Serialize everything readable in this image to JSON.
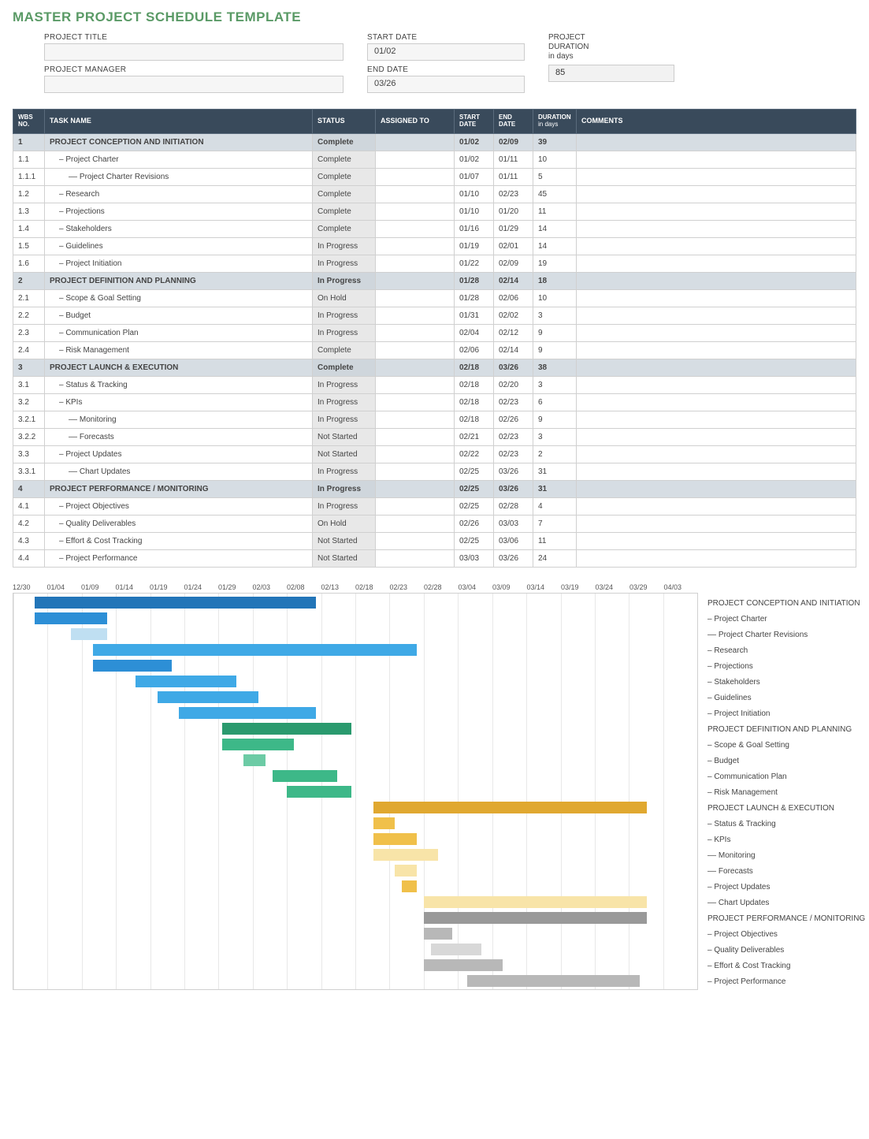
{
  "title": "MASTER PROJECT SCHEDULE TEMPLATE",
  "header": {
    "project_title_label": "PROJECT TITLE",
    "project_title": "",
    "project_manager_label": "PROJECT MANAGER",
    "project_manager": "",
    "start_date_label": "START DATE",
    "start_date": "01/02",
    "end_date_label": "END DATE",
    "end_date": "03/26",
    "project_duration_label1": "PROJECT",
    "project_duration_label2": "DURATION",
    "project_duration_unit": "in days",
    "project_duration": "85"
  },
  "columns": {
    "wbs": "WBS NO.",
    "task": "TASK NAME",
    "status": "STATUS",
    "assigned": "ASSIGNED TO",
    "start": "START DATE",
    "end": "END DATE",
    "duration": "DURATION",
    "duration_sub": "in days",
    "comments": "COMMENTS"
  },
  "rows": [
    {
      "sec": true,
      "wbs": "1",
      "task": "PROJECT CONCEPTION AND INITIATION",
      "status": "Complete",
      "assigned": "",
      "start": "01/02",
      "end": "02/09",
      "dur": "39",
      "comments": ""
    },
    {
      "wbs": "1.1",
      "task": "– Project Charter",
      "status": "Complete",
      "assigned": "",
      "start": "01/02",
      "end": "01/11",
      "dur": "10",
      "comments": ""
    },
    {
      "wbs": "1.1.1",
      "task": "–– Project Charter Revisions",
      "status": "Complete",
      "assigned": "",
      "start": "01/07",
      "end": "01/11",
      "dur": "5",
      "comments": ""
    },
    {
      "wbs": "1.2",
      "task": "– Research",
      "status": "Complete",
      "assigned": "",
      "start": "01/10",
      "end": "02/23",
      "dur": "45",
      "comments": ""
    },
    {
      "wbs": "1.3",
      "task": "– Projections",
      "status": "Complete",
      "assigned": "",
      "start": "01/10",
      "end": "01/20",
      "dur": "11",
      "comments": ""
    },
    {
      "wbs": "1.4",
      "task": "– Stakeholders",
      "status": "Complete",
      "assigned": "",
      "start": "01/16",
      "end": "01/29",
      "dur": "14",
      "comments": ""
    },
    {
      "wbs": "1.5",
      "task": "– Guidelines",
      "status": "In Progress",
      "assigned": "",
      "start": "01/19",
      "end": "02/01",
      "dur": "14",
      "comments": ""
    },
    {
      "wbs": "1.6",
      "task": "– Project Initiation",
      "status": "In Progress",
      "assigned": "",
      "start": "01/22",
      "end": "02/09",
      "dur": "19",
      "comments": ""
    },
    {
      "sec": true,
      "wbs": "2",
      "task": "PROJECT DEFINITION AND PLANNING",
      "status": "In Progress",
      "assigned": "",
      "start": "01/28",
      "end": "02/14",
      "dur": "18",
      "comments": ""
    },
    {
      "wbs": "2.1",
      "task": "– Scope & Goal Setting",
      "status": "On Hold",
      "assigned": "",
      "start": "01/28",
      "end": "02/06",
      "dur": "10",
      "comments": ""
    },
    {
      "wbs": "2.2",
      "task": "– Budget",
      "status": "In Progress",
      "assigned": "",
      "start": "01/31",
      "end": "02/02",
      "dur": "3",
      "comments": ""
    },
    {
      "wbs": "2.3",
      "task": "– Communication Plan",
      "status": "In Progress",
      "assigned": "",
      "start": "02/04",
      "end": "02/12",
      "dur": "9",
      "comments": ""
    },
    {
      "wbs": "2.4",
      "task": "– Risk Management",
      "status": "Complete",
      "assigned": "",
      "start": "02/06",
      "end": "02/14",
      "dur": "9",
      "comments": ""
    },
    {
      "sec": true,
      "wbs": "3",
      "task": "PROJECT LAUNCH & EXECUTION",
      "status": "Complete",
      "assigned": "",
      "start": "02/18",
      "end": "03/26",
      "dur": "38",
      "comments": ""
    },
    {
      "wbs": "3.1",
      "task": "– Status & Tracking",
      "status": "In Progress",
      "assigned": "",
      "start": "02/18",
      "end": "02/20",
      "dur": "3",
      "comments": ""
    },
    {
      "wbs": "3.2",
      "task": "– KPIs",
      "status": "In Progress",
      "assigned": "",
      "start": "02/18",
      "end": "02/23",
      "dur": "6",
      "comments": ""
    },
    {
      "wbs": "3.2.1",
      "task": "–– Monitoring",
      "status": "In Progress",
      "assigned": "",
      "start": "02/18",
      "end": "02/26",
      "dur": "9",
      "comments": ""
    },
    {
      "wbs": "3.2.2",
      "task": "–– Forecasts",
      "status": "Not Started",
      "assigned": "",
      "start": "02/21",
      "end": "02/23",
      "dur": "3",
      "comments": ""
    },
    {
      "wbs": "3.3",
      "task": "– Project Updates",
      "status": "Not Started",
      "assigned": "",
      "start": "02/22",
      "end": "02/23",
      "dur": "2",
      "comments": ""
    },
    {
      "wbs": "3.3.1",
      "task": "–– Chart Updates",
      "status": "In Progress",
      "assigned": "",
      "start": "02/25",
      "end": "03/26",
      "dur": "31",
      "comments": ""
    },
    {
      "sec": true,
      "wbs": "4",
      "task": "PROJECT PERFORMANCE / MONITORING",
      "status": "In Progress",
      "assigned": "",
      "start": "02/25",
      "end": "03/26",
      "dur": "31",
      "comments": ""
    },
    {
      "wbs": "4.1",
      "task": "– Project Objectives",
      "status": "In Progress",
      "assigned": "",
      "start": "02/25",
      "end": "02/28",
      "dur": "4",
      "comments": ""
    },
    {
      "wbs": "4.2",
      "task": "– Quality Deliverables",
      "status": "On Hold",
      "assigned": "",
      "start": "02/26",
      "end": "03/03",
      "dur": "7",
      "comments": ""
    },
    {
      "wbs": "4.3",
      "task": "– Effort & Cost Tracking",
      "status": "Not Started",
      "assigned": "",
      "start": "02/25",
      "end": "03/06",
      "dur": "11",
      "comments": ""
    },
    {
      "wbs": "4.4",
      "task": "– Project Performance",
      "status": "Not Started",
      "assigned": "",
      "start": "03/03",
      "end": "03/26",
      "dur": "24",
      "comments": ""
    }
  ],
  "chart_data": {
    "type": "bar",
    "axis": [
      "12/30",
      "01/04",
      "01/09",
      "01/14",
      "01/19",
      "01/24",
      "01/29",
      "02/03",
      "02/08",
      "02/13",
      "02/18",
      "02/23",
      "02/28",
      "03/04",
      "03/09",
      "03/14",
      "03/19",
      "03/24",
      "03/29",
      "04/03"
    ],
    "range_start": "12/30",
    "range_end": "04/03",
    "total_days": 95,
    "series": [
      {
        "name": "PROJECT CONCEPTION AND INITIATION",
        "start_offset": 3,
        "dur": 39,
        "color": "c-bluedark"
      },
      {
        "name": "– Project Charter",
        "start_offset": 3,
        "dur": 10,
        "color": "c-blue"
      },
      {
        "name": "–– Project Charter Revisions",
        "start_offset": 8,
        "dur": 5,
        "color": "c-bluelite"
      },
      {
        "name": "– Research",
        "start_offset": 11,
        "dur": 45,
        "color": "c-bluemid"
      },
      {
        "name": "– Projections",
        "start_offset": 11,
        "dur": 11,
        "color": "c-blue"
      },
      {
        "name": "– Stakeholders",
        "start_offset": 17,
        "dur": 14,
        "color": "c-bluemid"
      },
      {
        "name": "– Guidelines",
        "start_offset": 20,
        "dur": 14,
        "color": "c-bluemid"
      },
      {
        "name": "– Project Initiation",
        "start_offset": 23,
        "dur": 19,
        "color": "c-bluemid"
      },
      {
        "name": "PROJECT DEFINITION AND PLANNING",
        "start_offset": 29,
        "dur": 18,
        "color": "c-greendark"
      },
      {
        "name": "– Scope & Goal Setting",
        "start_offset": 29,
        "dur": 10,
        "color": "c-green"
      },
      {
        "name": "– Budget",
        "start_offset": 32,
        "dur": 3,
        "color": "c-greenlite"
      },
      {
        "name": "– Communication Plan",
        "start_offset": 36,
        "dur": 9,
        "color": "c-green"
      },
      {
        "name": "– Risk Management",
        "start_offset": 38,
        "dur": 9,
        "color": "c-green"
      },
      {
        "name": "PROJECT LAUNCH & EXECUTION",
        "start_offset": 50,
        "dur": 38,
        "color": "c-yellowdark"
      },
      {
        "name": "– Status & Tracking",
        "start_offset": 50,
        "dur": 3,
        "color": "c-yellow"
      },
      {
        "name": "– KPIs",
        "start_offset": 50,
        "dur": 6,
        "color": "c-yellow"
      },
      {
        "name": "–– Monitoring",
        "start_offset": 50,
        "dur": 9,
        "color": "c-yellowlite"
      },
      {
        "name": "–– Forecasts",
        "start_offset": 53,
        "dur": 3,
        "color": "c-yellowlite"
      },
      {
        "name": "– Project Updates",
        "start_offset": 54,
        "dur": 2,
        "color": "c-yellow"
      },
      {
        "name": "–– Chart Updates",
        "start_offset": 57,
        "dur": 31,
        "color": "c-yellowlite"
      },
      {
        "name": "PROJECT PERFORMANCE / MONITORING",
        "start_offset": 57,
        "dur": 31,
        "color": "c-greydark"
      },
      {
        "name": "– Project Objectives",
        "start_offset": 57,
        "dur": 4,
        "color": "c-grey"
      },
      {
        "name": "– Quality Deliverables",
        "start_offset": 58,
        "dur": 7,
        "color": "c-greylite"
      },
      {
        "name": "– Effort & Cost Tracking",
        "start_offset": 57,
        "dur": 11,
        "color": "c-grey"
      },
      {
        "name": "– Project Performance",
        "start_offset": 63,
        "dur": 24,
        "color": "c-grey"
      }
    ]
  }
}
